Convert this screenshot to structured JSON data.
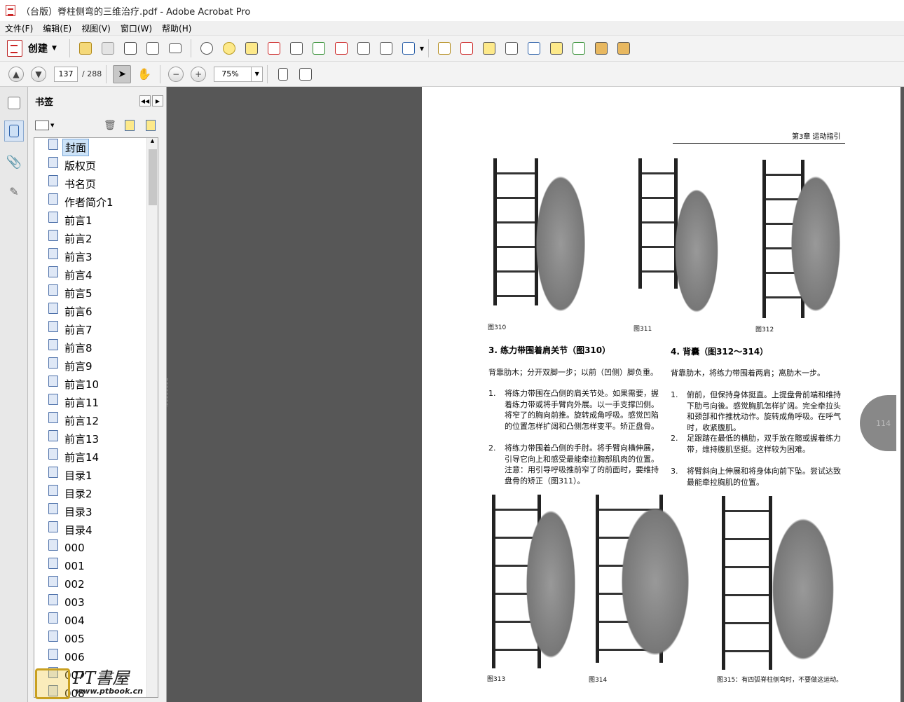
{
  "window": {
    "title": "（台版）脊柱侧弯的三维治疗.pdf - Adobe Acrobat Pro"
  },
  "menu": [
    "文件(F)",
    "编辑(E)",
    "视图(V)",
    "窗口(W)",
    "帮助(H)"
  ],
  "toolbar": {
    "create_label": "创建"
  },
  "nav": {
    "page_current": "137",
    "page_total": "/ 288",
    "zoom": "75%"
  },
  "panel": {
    "title": "书签"
  },
  "bookmarks": [
    "封面",
    "版权页",
    "书名页",
    "作者简介1",
    "前言1",
    "前言2",
    "前言3",
    "前言4",
    "前言5",
    "前言6",
    "前言7",
    "前言8",
    "前言9",
    "前言10",
    "前言11",
    "前言12",
    "前言13",
    "前言14",
    "目录1",
    "目录2",
    "目录3",
    "目录4",
    "000",
    "001",
    "002",
    "003",
    "004",
    "005",
    "006",
    "007",
    "008"
  ],
  "page": {
    "header": "第3章  运动指引",
    "captions": [
      "图310",
      "图311",
      "图312",
      "图313",
      "图314"
    ],
    "caption315": "图315：有四弧脊柱侧弯时，不要做这运动。",
    "sec3_title": "3. 练力带围着肩关节（图310）",
    "sec3_intro": "背靠肋木；分开双脚一步；以前（凹侧）脚负重。",
    "sec3_items": [
      "将练力带围在凸侧的肩关节处。如果需要，握着练力带或将手臂向外展。以一手支撑凹侧。将窄了的胸向前推。旋转成角呼吸。感觉凹陷的位置怎样扩阔和凸侧怎样变平。矫正盘骨。",
      "将练力带围着凸侧的手肘。将手臂向横伸展，引导它向上和感受最能牵拉胸部肌肉的位置。注意：用引导呼吸推前窄了的前面时，要维持盘骨的矫正（图311）。"
    ],
    "sec4_title": "4. 背囊（图312～314）",
    "sec4_intro": "背靠肋木，将练力带围着两肩；离肋木一步。",
    "sec4_items": [
      "俯前，但保持身体挺直。上提盘骨前端和维持下肋弓向後。感觉胸肌怎样扩阔。完全牵拉头和颈部和作推枕动作。旋转成角呼吸。在呼气时，收紧腹肌。",
      "足跟踏在最低的横肋，双手放在髋或握着练力带，维持腹肌坚挺。这样较为困难。",
      "将臂斜向上伸展和将身体向前下坠。尝试达致最能牵拉胸肌的位置。"
    ],
    "page_number": "114"
  },
  "watermark": {
    "line1": "PT書屋",
    "line2": "www.ptbook.cn"
  }
}
